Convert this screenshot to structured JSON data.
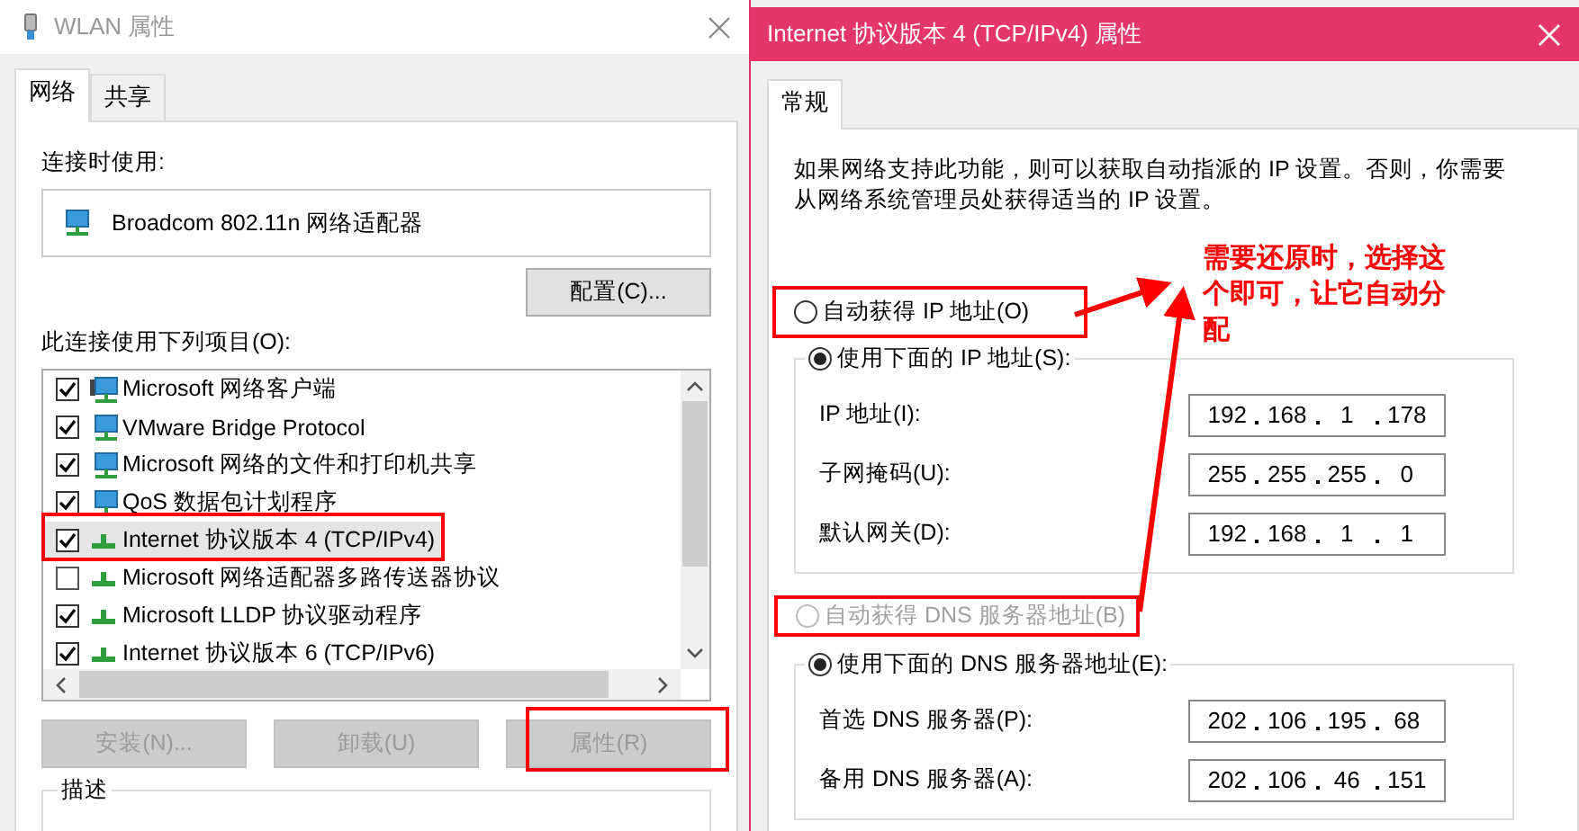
{
  "left_window": {
    "title": "WLAN 属性",
    "tabs": [
      {
        "label": "网络",
        "selected": true
      },
      {
        "label": "共享",
        "selected": false
      }
    ],
    "connect_using_label": "连接时使用:",
    "adapter_name": "Broadcom 802.11n 网络适配器",
    "configure_button": "配置(C)...",
    "items_label": "此连接使用下列项目(O):",
    "items": [
      {
        "label": "Microsoft 网络客户端",
        "kind": "client",
        "checked": true,
        "selected": false
      },
      {
        "label": "VMware Bridge Protocol",
        "kind": "service",
        "checked": true,
        "selected": false
      },
      {
        "label": "Microsoft 网络的文件和打印机共享",
        "kind": "service",
        "checked": true,
        "selected": false
      },
      {
        "label": "QoS 数据包计划程序",
        "kind": "service",
        "checked": true,
        "selected": false
      },
      {
        "label": "Internet 协议版本 4 (TCP/IPv4)",
        "kind": "protocol",
        "checked": true,
        "selected": true
      },
      {
        "label": "Microsoft 网络适配器多路传送器协议",
        "kind": "protocol",
        "checked": false,
        "selected": false
      },
      {
        "label": "Microsoft LLDP 协议驱动程序",
        "kind": "protocol",
        "checked": true,
        "selected": false
      },
      {
        "label": "Internet 协议版本 6 (TCP/IPv6)",
        "kind": "protocol",
        "checked": true,
        "selected": false
      }
    ],
    "buttons": [
      {
        "label": "安装(N)...",
        "disabled": true
      },
      {
        "label": "卸载(U)",
        "disabled": true
      },
      {
        "label": "属性(R)",
        "disabled": true
      }
    ],
    "description_label": "描述"
  },
  "right_window": {
    "title": "Internet 协议版本 4 (TCP/IPv4) 属性",
    "tabs": [
      {
        "label": "常规",
        "selected": true
      }
    ],
    "intro": "如果网络支持此功能，则可以获取自动指派的 IP 设置。否则，你需要从网络系统管理员处获得适当的 IP 设置。",
    "ip_options": [
      {
        "label": "自动获得 IP 地址(O)",
        "selected": false,
        "disabled": false
      },
      {
        "label": "使用下面的 IP 地址(S):",
        "selected": true,
        "disabled": false
      }
    ],
    "ip_fields": [
      {
        "label": "IP 地址(I):",
        "octets": [
          "192",
          "168",
          "1",
          "178"
        ]
      },
      {
        "label": "子网掩码(U):",
        "octets": [
          "255",
          "255",
          "255",
          "0"
        ]
      },
      {
        "label": "默认网关(D):",
        "octets": [
          "192",
          "168",
          "1",
          "1"
        ]
      }
    ],
    "dns_options": [
      {
        "label": "自动获得 DNS 服务器地址(B)",
        "selected": false,
        "disabled": true
      },
      {
        "label": "使用下面的 DNS 服务器地址(E):",
        "selected": true,
        "disabled": false
      }
    ],
    "dns_fields": [
      {
        "label": "首选 DNS 服务器(P):",
        "octets": [
          "202",
          "106",
          "195",
          "68"
        ]
      },
      {
        "label": "备用 DNS 服务器(A):",
        "octets": [
          "202",
          "106",
          "46",
          "151"
        ]
      }
    ]
  },
  "annotation": {
    "text": "需要还原时，选择这个即可，让它自动分配"
  }
}
